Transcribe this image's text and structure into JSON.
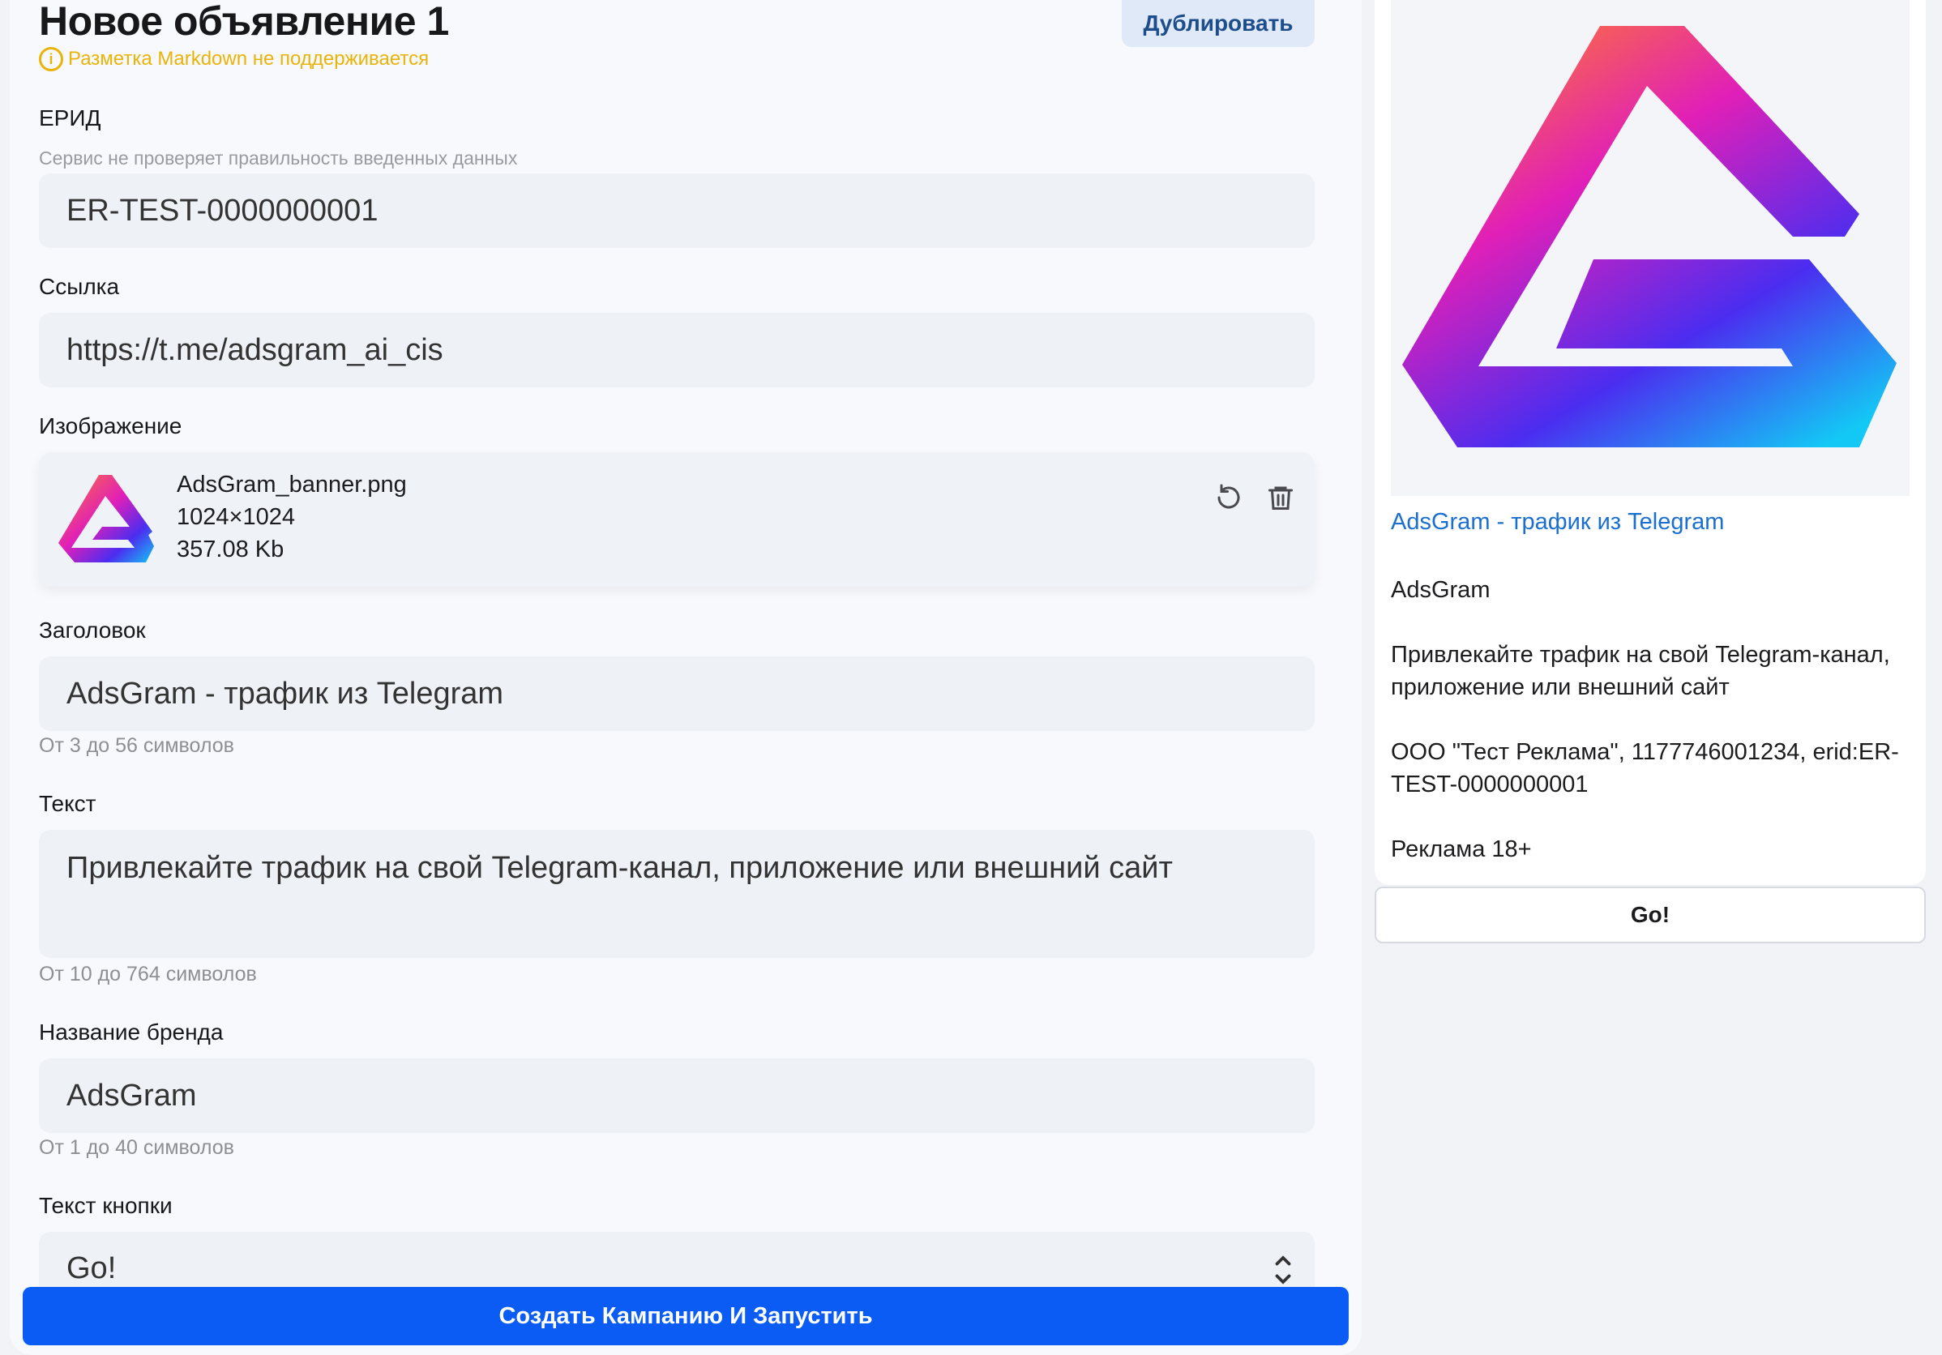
{
  "form": {
    "title": "Новое объявление 1",
    "duplicate_label": "Дублировать",
    "markdown_warning": "Разметка Markdown не поддерживается",
    "erid": {
      "label": "ЕРИД",
      "hint": "Сервис не проверяет правильность введенных данных",
      "value": "ER-TEST-0000000001"
    },
    "link": {
      "label": "Ссылка",
      "value": "https://t.me/adsgram_ai_cis"
    },
    "image": {
      "label": "Изображение",
      "file_name": "AdsGram_banner.png",
      "dimensions": "1024×1024",
      "size": "357.08 Kb"
    },
    "headline": {
      "label": "Заголовок",
      "value": "AdsGram - трафик из Telegram",
      "hint": "От 3 до 56 символов"
    },
    "text": {
      "label": "Текст",
      "value": "Привлекайте трафик на свой Telegram-канал, приложение или внешний сайт",
      "hint": "От 10 до 764 символов"
    },
    "brand": {
      "label": "Название бренда",
      "value": "AdsGram",
      "hint": "От 1 до 40 символов"
    },
    "button_text": {
      "label": "Текст кнопки",
      "value": "Go!"
    },
    "submit_label": "Создать Кампанию И Запустить"
  },
  "preview": {
    "title": "AdsGram - трафик из Telegram",
    "brand": "AdsGram",
    "text": "Привлекайте трафик на свой Telegram-канал, приложение или внешний сайт",
    "legal": "ООО \"Тест Реклама\", 1177746001234, erid:ER-TEST-0000000001",
    "age": "Реклама 18+",
    "button": "Go!"
  },
  "colors": {
    "accent": "#0a5cf5",
    "warning": "#eab308",
    "link": "#1a6fd0"
  },
  "icons": {
    "warning": "info-circle-icon",
    "replace": "rotate-ccw-icon",
    "delete": "trash-icon",
    "select": "chevron-up-down-icon"
  }
}
